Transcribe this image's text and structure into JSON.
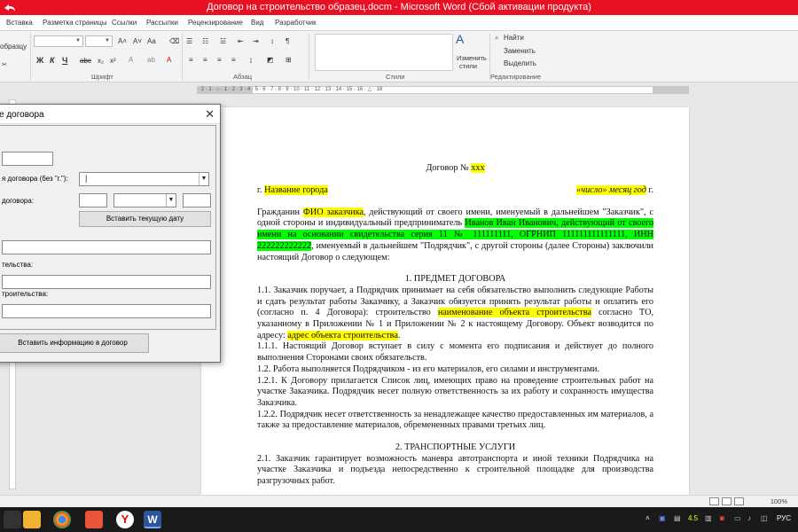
{
  "window": {
    "title": "Договор на строительство образец.docm  -  Microsoft Word (Сбой активации продукта)"
  },
  "ribbon": {
    "tabs": [
      "Вставка",
      "Разметка страницы",
      "Ссылки",
      "Рассылки",
      "Рецензирование",
      "Вид",
      "Разработчик"
    ],
    "clipboard_partial": "образцу",
    "group_labels": {
      "font": "Шрифт",
      "paragraph": "Абзац",
      "styles": "Стили",
      "editing": "Редактирование"
    },
    "format_buttons": [
      "Ж",
      "К",
      "Ч",
      "abc",
      "x₂",
      "x²"
    ],
    "change_styles_label_1": "Изменить",
    "change_styles_label_2": "стили",
    "find_label": "Найти",
    "replace_label": "Заменить",
    "select_label": "Выделить"
  },
  "ruler": {
    "marks": "· 2 · 1 · ⌂ · 1 · 2 · 3 · 4 · 5 · 6 · 7 · 8 · 9 · 10 · 11 · 12 · 13 · 14 · 15 · 16 · △ · 18"
  },
  "dialog": {
    "title_partial": "е договора",
    "close_glyph": "✕",
    "labels": {
      "contract_number": "я договора (без \"г.\"):",
      "contract_date": "договора:",
      "field_building": "тельства:",
      "field_building_object": "троительства:"
    },
    "insert_date_button": "Вставить текущую дату",
    "insert_info_button": "Вставить информацию в договор"
  },
  "document": {
    "heading_label": "Договор № ",
    "heading_number": "xxx",
    "city_prefix": "г. ",
    "city": "Название города",
    "date_placeholder": "«число» месяц год",
    "date_suffix": " г.",
    "para1_a": "Гражданин ",
    "para1_customer": "ФИО заказчика",
    "para1_b": ", действующий от своего имени, именуемый в дальнейшем \"Заказчик\", с одной стороны и индивидуальный предприниматель ",
    "para1_contractor": "Иванов Иван Иванович, действующий от своего имени на основании свидетельства серия 11 № 111111111, ОГРНИП 111111111111111, ИНН 222222222222",
    "para1_c": ", именуемый в дальнейшем \"Подрядчик\", с другой стороны (далее Стороны) заключили настоящий Договор о следующем:",
    "section1_title": "1. ПРЕДМЕТ ДОГОВОРА",
    "p1_1a": "1.1. Заказчик поручает, а Подрядчик принимает на себя обязательство выполнить следующие Работы и сдать результат работы Заказчику, а Заказчик обязуется принять результат работы и оплатить его (согласно п. 4 Договора): строительство ",
    "p1_1_object": "наименование объекта строительства",
    "p1_1b": " согласно ТО, указанному в Приложении № 1 и Приложении № 2 к настоящему Договору. Объект возводится по адресу: ",
    "p1_1_address": "адрес объекта строительства",
    "p1_1c": ".",
    "p1_1_1": "1.1.1. Настоящий Договор вступает в силу с момента его подписания и действует до полного выполнения Сторонами своих обязательств.",
    "p1_2": "1.2. Работа выполняется Подрядчиком - из его материалов, его силами и инструментами.",
    "p1_2_1": "1.2.1. К Договору прилагается Список лиц, имеющих право на проведение строительных работ на участке Заказчика. Подрядчик несет полную ответственность за их работу и сохранность имущества Заказчика.",
    "p1_2_2": "1.2.2. Подрядчик несет ответственность за ненадлежащее качество предоставленных им материалов, а также за предоставление материалов, обремененных правами третьих лиц.",
    "section2_title": "2. ТРАНСПОРТНЫЕ УСЛУГИ",
    "p2_1": "2.1. Заказчик гарантирует возможность маневра автотранспорта и иной техники Подрядчика на участке Заказчика и подъезда непосредственно к строительной площадке для производства разгрузочных работ."
  },
  "statusbar": {
    "zoom": "100%"
  },
  "taskbar": {
    "tray_number": "4.5",
    "language": "РУС"
  },
  "colors": {
    "titlebar": "#e81123",
    "highlight_yellow": "#ffff00",
    "highlight_green": "#00ff00",
    "taskbar": "#1a1a1a"
  }
}
